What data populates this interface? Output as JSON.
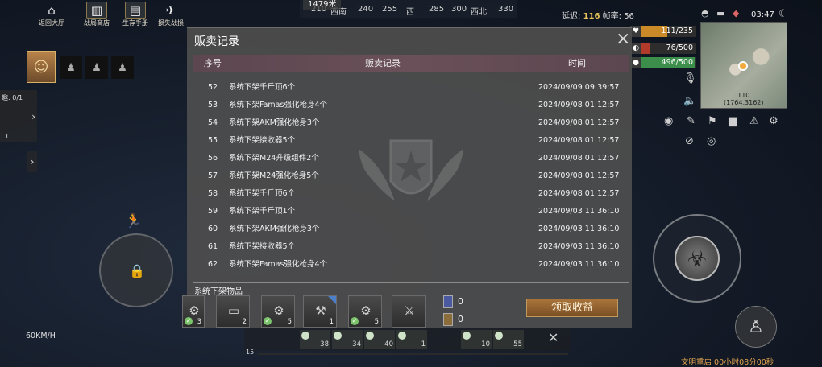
{
  "top_left": {
    "buttons": [
      {
        "label": "返回大厅",
        "icon": "home-icon"
      },
      {
        "label": "战局商店",
        "icon": "shop-icon"
      },
      {
        "label": "生存手册",
        "icon": "manual-icon"
      },
      {
        "label": "损失战损",
        "icon": "wing-icon"
      }
    ]
  },
  "compass": {
    "distance": "1479米",
    "ticks": [
      "210",
      "西南",
      "240",
      "255",
      "西",
      "285",
      "300",
      "西北",
      "330"
    ]
  },
  "net": {
    "latency_label": "延迟:",
    "latency_value": "116",
    "fps_label": "帧率:",
    "fps_value": "56"
  },
  "stats": {
    "health": "111/235",
    "food": "76/500",
    "water": "496/500",
    "health_fraction": 0.47,
    "food_fraction": 0.15,
    "water_fraction": 0.99,
    "health_color": "#c98a27",
    "food_color": "#b23a2a",
    "water_color": "#3b8f4b"
  },
  "clock": "03:47",
  "minimap": {
    "coords_line1": "110",
    "coords_line2": "(1764,3162)"
  },
  "left_hud": {
    "speed": "60KM/H",
    "tab_label": "趣: 0/1",
    "tab_count": "1"
  },
  "dialog": {
    "title": "贩卖记录",
    "columns": {
      "no": "序号",
      "record": "贩卖记录",
      "time": "时间"
    },
    "rows": [
      {
        "no": "52",
        "record": "系统下架千斤顶6个",
        "time": "2024/09/09 09:39:57"
      },
      {
        "no": "53",
        "record": "系统下架Famas强化枪身4个",
        "time": "2024/09/08 01:12:57"
      },
      {
        "no": "54",
        "record": "系统下架AKM强化枪身3个",
        "time": "2024/09/08 01:12:57"
      },
      {
        "no": "55",
        "record": "系统下架接收器5个",
        "time": "2024/09/08 01:12:57"
      },
      {
        "no": "56",
        "record": "系统下架M24升级组件2个",
        "time": "2024/09/08 01:12:57"
      },
      {
        "no": "57",
        "record": "系统下架M24强化枪身5个",
        "time": "2024/09/08 01:12:57"
      },
      {
        "no": "58",
        "record": "系统下架千斤顶6个",
        "time": "2024/09/08 01:12:57"
      },
      {
        "no": "59",
        "record": "系统下架千斤顶1个",
        "time": "2024/09/03 11:36:10"
      },
      {
        "no": "60",
        "record": "系统下架AKM强化枪身3个",
        "time": "2024/09/03 11:36:10"
      },
      {
        "no": "61",
        "record": "系统下架接收器5个",
        "time": "2024/09/03 11:36:10"
      },
      {
        "no": "62",
        "record": "系统下架Famas强化枪身4个",
        "time": "2024/09/03 11:36:10"
      }
    ],
    "section_label": "系统下架物品",
    "items": [
      {
        "qty": "3",
        "checked": true,
        "icon": "gun-part-icon"
      },
      {
        "qty": "2",
        "checked": false,
        "icon": "box-icon"
      },
      {
        "qty": "5",
        "checked": true,
        "icon": "gun-part-icon"
      },
      {
        "qty": "1",
        "checked": false,
        "icon": "gun-part-icon"
      },
      {
        "qty": "5",
        "checked": true,
        "icon": "gun-part-icon"
      },
      {
        "qty": "",
        "checked": false,
        "icon": "gun-part-icon"
      }
    ],
    "currency": [
      {
        "icon": "card-icon",
        "amount": "0"
      },
      {
        "icon": "coin-icon",
        "amount": "0"
      }
    ],
    "claim_label": "领取收益"
  },
  "hotbar": {
    "slots": [
      "38",
      "34",
      "40",
      "1",
      "10",
      "55"
    ],
    "level": "15"
  },
  "bottom_right": {
    "civ_time": "文明重启 00小时08分00秒"
  }
}
